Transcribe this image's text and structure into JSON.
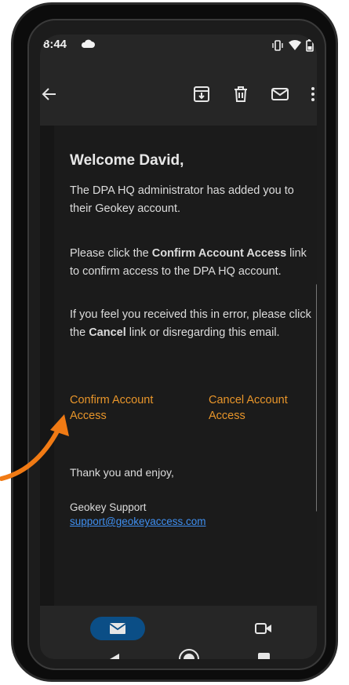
{
  "status_bar": {
    "time": "8:44"
  },
  "app_bar": {
    "icons": [
      "back-arrow-icon",
      "archive-icon",
      "delete-icon",
      "mail-icon",
      "more-vert-icon"
    ]
  },
  "email": {
    "greeting": "Welcome David,",
    "p1": "The DPA HQ administrator has added you to their Geokey account.",
    "p2_prefix": "Please click the ",
    "p2_bold": "Confirm Account Access",
    "p2_suffix": " link to confirm access to the DPA HQ account.",
    "p3_prefix": "If you feel you received this in error, please click the ",
    "p3_bold": "Cancel",
    "p3_suffix": " link or disregarding this email.",
    "confirm_link": "Confirm Account Access",
    "cancel_link": "Cancel Account Access",
    "thanks": "Thank you and enjoy,",
    "signature_name": "Geokey Support",
    "signature_email": "support@geokeyaccess.com"
  },
  "bottom_nav": {
    "items": [
      "mail-icon",
      "video-icon"
    ]
  },
  "system_nav": {
    "items": [
      "back-icon",
      "home-icon",
      "recents-icon"
    ]
  },
  "colors": {
    "accent_orange": "#e8952a",
    "link_blue": "#3f8ff0",
    "nav_pill": "#0b4e86",
    "annotation": "#f07a14"
  }
}
